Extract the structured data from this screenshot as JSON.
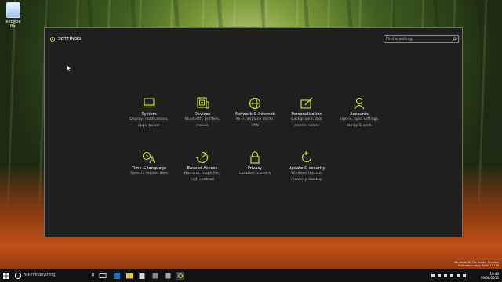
{
  "desktop": {
    "recycle_bin_label": "Recycle Bin"
  },
  "window": {
    "title": "SETTINGS",
    "search_placeholder": "Find a setting"
  },
  "categories": [
    {
      "title": "System",
      "desc1": "Display, notifications,",
      "desc2": "apps, power",
      "icon": "laptop-icon"
    },
    {
      "title": "Devices",
      "desc1": "Bluetooth, printers,",
      "desc2": "mouse",
      "icon": "devices-icon"
    },
    {
      "title": "Network & Internet",
      "desc1": "Wi-Fi, airplane mode,",
      "desc2": "VPN",
      "icon": "globe-icon"
    },
    {
      "title": "Personalization",
      "desc1": "Background, lock",
      "desc2": "screen, colors",
      "icon": "paint-icon"
    },
    {
      "title": "Accounts",
      "desc1": "Sign-in, sync settings,",
      "desc2": "family & work",
      "icon": "person-icon"
    },
    {
      "title": "Time & language",
      "desc1": "Speech, region, date",
      "desc2": "",
      "icon": "time-language-icon"
    },
    {
      "title": "Ease of Access",
      "desc1": "Narrator, magnifier,",
      "desc2": "high contrast",
      "icon": "ease-of-access-icon"
    },
    {
      "title": "Privacy",
      "desc1": "Location, camera",
      "desc2": "",
      "icon": "lock-icon"
    },
    {
      "title": "Update & security",
      "desc1": "Windows Update,",
      "desc2": "recovery, backup",
      "icon": "refresh-icon"
    }
  ],
  "taskbar": {
    "search_placeholder": "Ask me anything"
  },
  "watermark": {
    "line1": "Windows 10 Pro Insider Preview",
    "line2": "Evaluation copy. Build 10130"
  },
  "clock": {
    "time": "10:43",
    "date": "09/06/2015"
  },
  "colors": {
    "accent": "#c8d84a",
    "window_bg": "#1f1f1f"
  }
}
